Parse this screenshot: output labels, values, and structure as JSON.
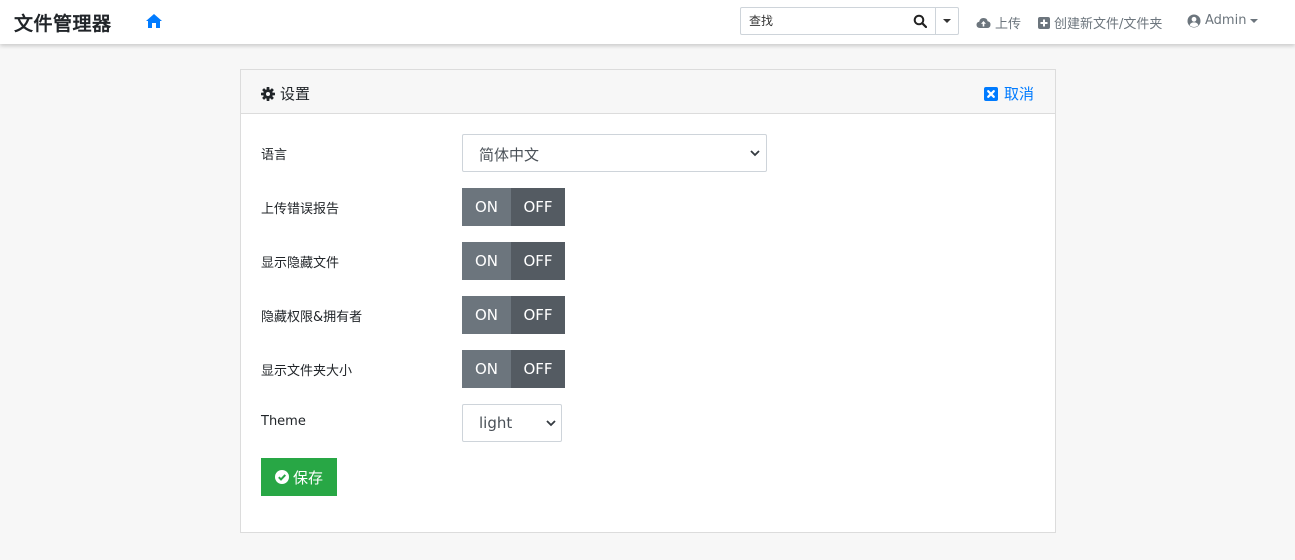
{
  "navbar": {
    "brand": "文件管理器",
    "search_placeholder": "查找",
    "upload_label": "上传",
    "new_label": "创建新文件/文件夹",
    "admin_label": "Admin"
  },
  "settings": {
    "title": "设置",
    "cancel_label": "取消",
    "language_label": "语言",
    "language_value": "简体中文",
    "toggles": [
      {
        "label": "上传错误报告",
        "on": "ON",
        "off": "OFF"
      },
      {
        "label": "显示隐藏文件",
        "on": "ON",
        "off": "OFF"
      },
      {
        "label": "隐藏权限&拥有者",
        "on": "ON",
        "off": "OFF"
      },
      {
        "label": "显示文件夹大小",
        "on": "ON",
        "off": "OFF"
      }
    ],
    "theme_label": "Theme",
    "theme_value": "light",
    "save_label": "保存"
  },
  "colors": {
    "accent": "#007bff",
    "success": "#28a745",
    "toggle_on": "#6c757d",
    "toggle_off": "#545b62"
  }
}
